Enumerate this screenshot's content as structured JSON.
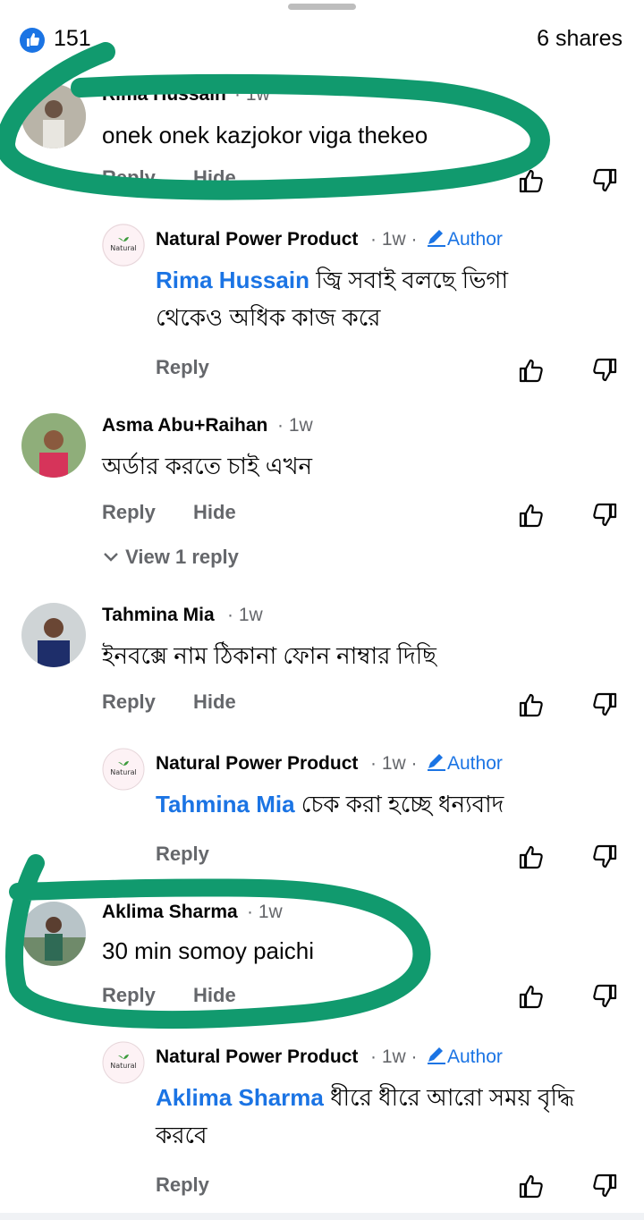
{
  "header": {
    "like_count": "151",
    "shares": "6 shares"
  },
  "comments": [
    {
      "name": "Rima Hussain",
      "time": "1w",
      "text": "onek onek kazjokor viga thekeo",
      "reply": "Reply",
      "hide": "Hide"
    },
    {
      "name": "Natural Power Product",
      "time": "1w",
      "author": "Author",
      "mention": "Rima Hussain",
      "text": "জ্বি সবাই বলছে ভিগা থেকেও অধিক কাজ করে",
      "reply": "Reply"
    },
    {
      "name": "Asma Abu+Raihan",
      "time": "1w",
      "text": "অর্ডার করতে চাই এখন",
      "reply": "Reply",
      "hide": "Hide",
      "view_replies": "View 1 reply"
    },
    {
      "name": "Tahmina Mia",
      "time": "1w",
      "text": "ইনবক্সে নাম ঠিকানা ফোন নাম্বার দিছি",
      "reply": "Reply",
      "hide": "Hide"
    },
    {
      "name": "Natural Power Product",
      "time": "1w",
      "author": "Author",
      "mention": "Tahmina Mia",
      "text": "চেক করা হচ্ছে ধন্যবাদ",
      "reply": "Reply"
    },
    {
      "name": "Aklima Sharma",
      "time": "1w",
      "text": "30 min somoy paichi",
      "reply": "Reply",
      "hide": "Hide"
    },
    {
      "name": "Natural Power Product",
      "time": "1w",
      "author": "Author",
      "mention": "Aklima Sharma",
      "text": "ধীরে ধীরে আরো সময় বৃদ্ধি করবে",
      "reply": "Reply"
    }
  ],
  "page_logo_text": "Natural",
  "colors": {
    "accent": "#1b74e4",
    "highlight": "#119a6e",
    "muted": "#65676b"
  }
}
